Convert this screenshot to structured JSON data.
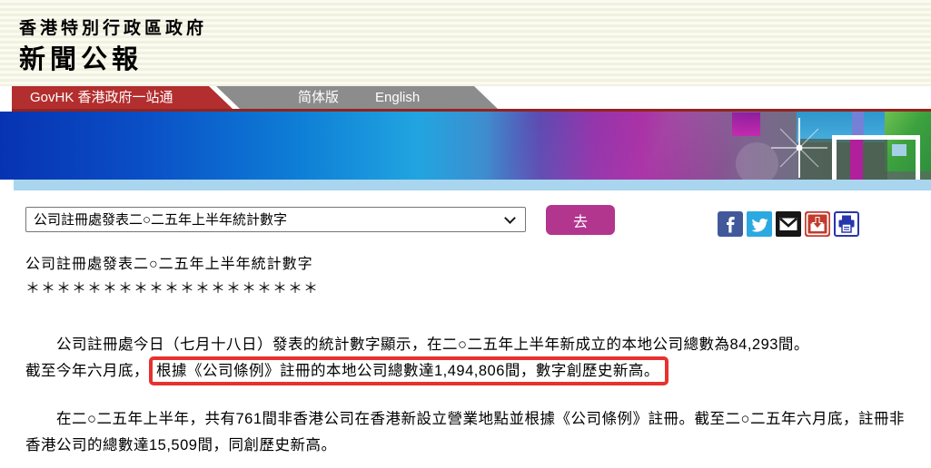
{
  "header": {
    "government": "香港特別行政區政府",
    "site_title": "新聞公報"
  },
  "nav": {
    "govhk_tab": "GovHK 香港政府一站通",
    "simplified_tab": "简体版",
    "english_tab": "English"
  },
  "toolbar": {
    "selected_release": "公司註冊處發表二○二五年上半年統計數字",
    "go_button": "去"
  },
  "share": {
    "items": [
      {
        "name": "facebook"
      },
      {
        "name": "twitter"
      },
      {
        "name": "email"
      },
      {
        "name": "save"
      },
      {
        "name": "print"
      }
    ]
  },
  "article": {
    "title": "公司註冊處發表二○二五年上半年統計數字",
    "separator": "＊＊＊＊＊＊＊＊＊＊＊＊＊＊＊＊＊＊＊",
    "p1_line1": "　　公司註冊處今日（七月十八日）發表的統計數字顯示，在二○二五年上半年新成立的本地公司總數為84,293間。",
    "p1_line2_prefix": "截至今年六月底，",
    "p1_highlight": "根據《公司條例》註冊的本地公司總數達1,494,806間，數字創歷史新高。",
    "p2": "　　在二○二五年上半年，共有761間非香港公司在香港新設立營業地點並根據《公司條例》註冊。截至二○二五年六月底，註冊非香港公司的總數達15,509間，同創歷史新高。"
  },
  "colors": {
    "red_tab": "#b32e2e",
    "gray_tab": "#8c8c8c",
    "go_button": "#b2358e",
    "highlight_border": "#e8312e",
    "banner_blue": "#0733b2",
    "banner_magenta": "#a21f9e",
    "bottom_bar": "#a9d5ef"
  }
}
